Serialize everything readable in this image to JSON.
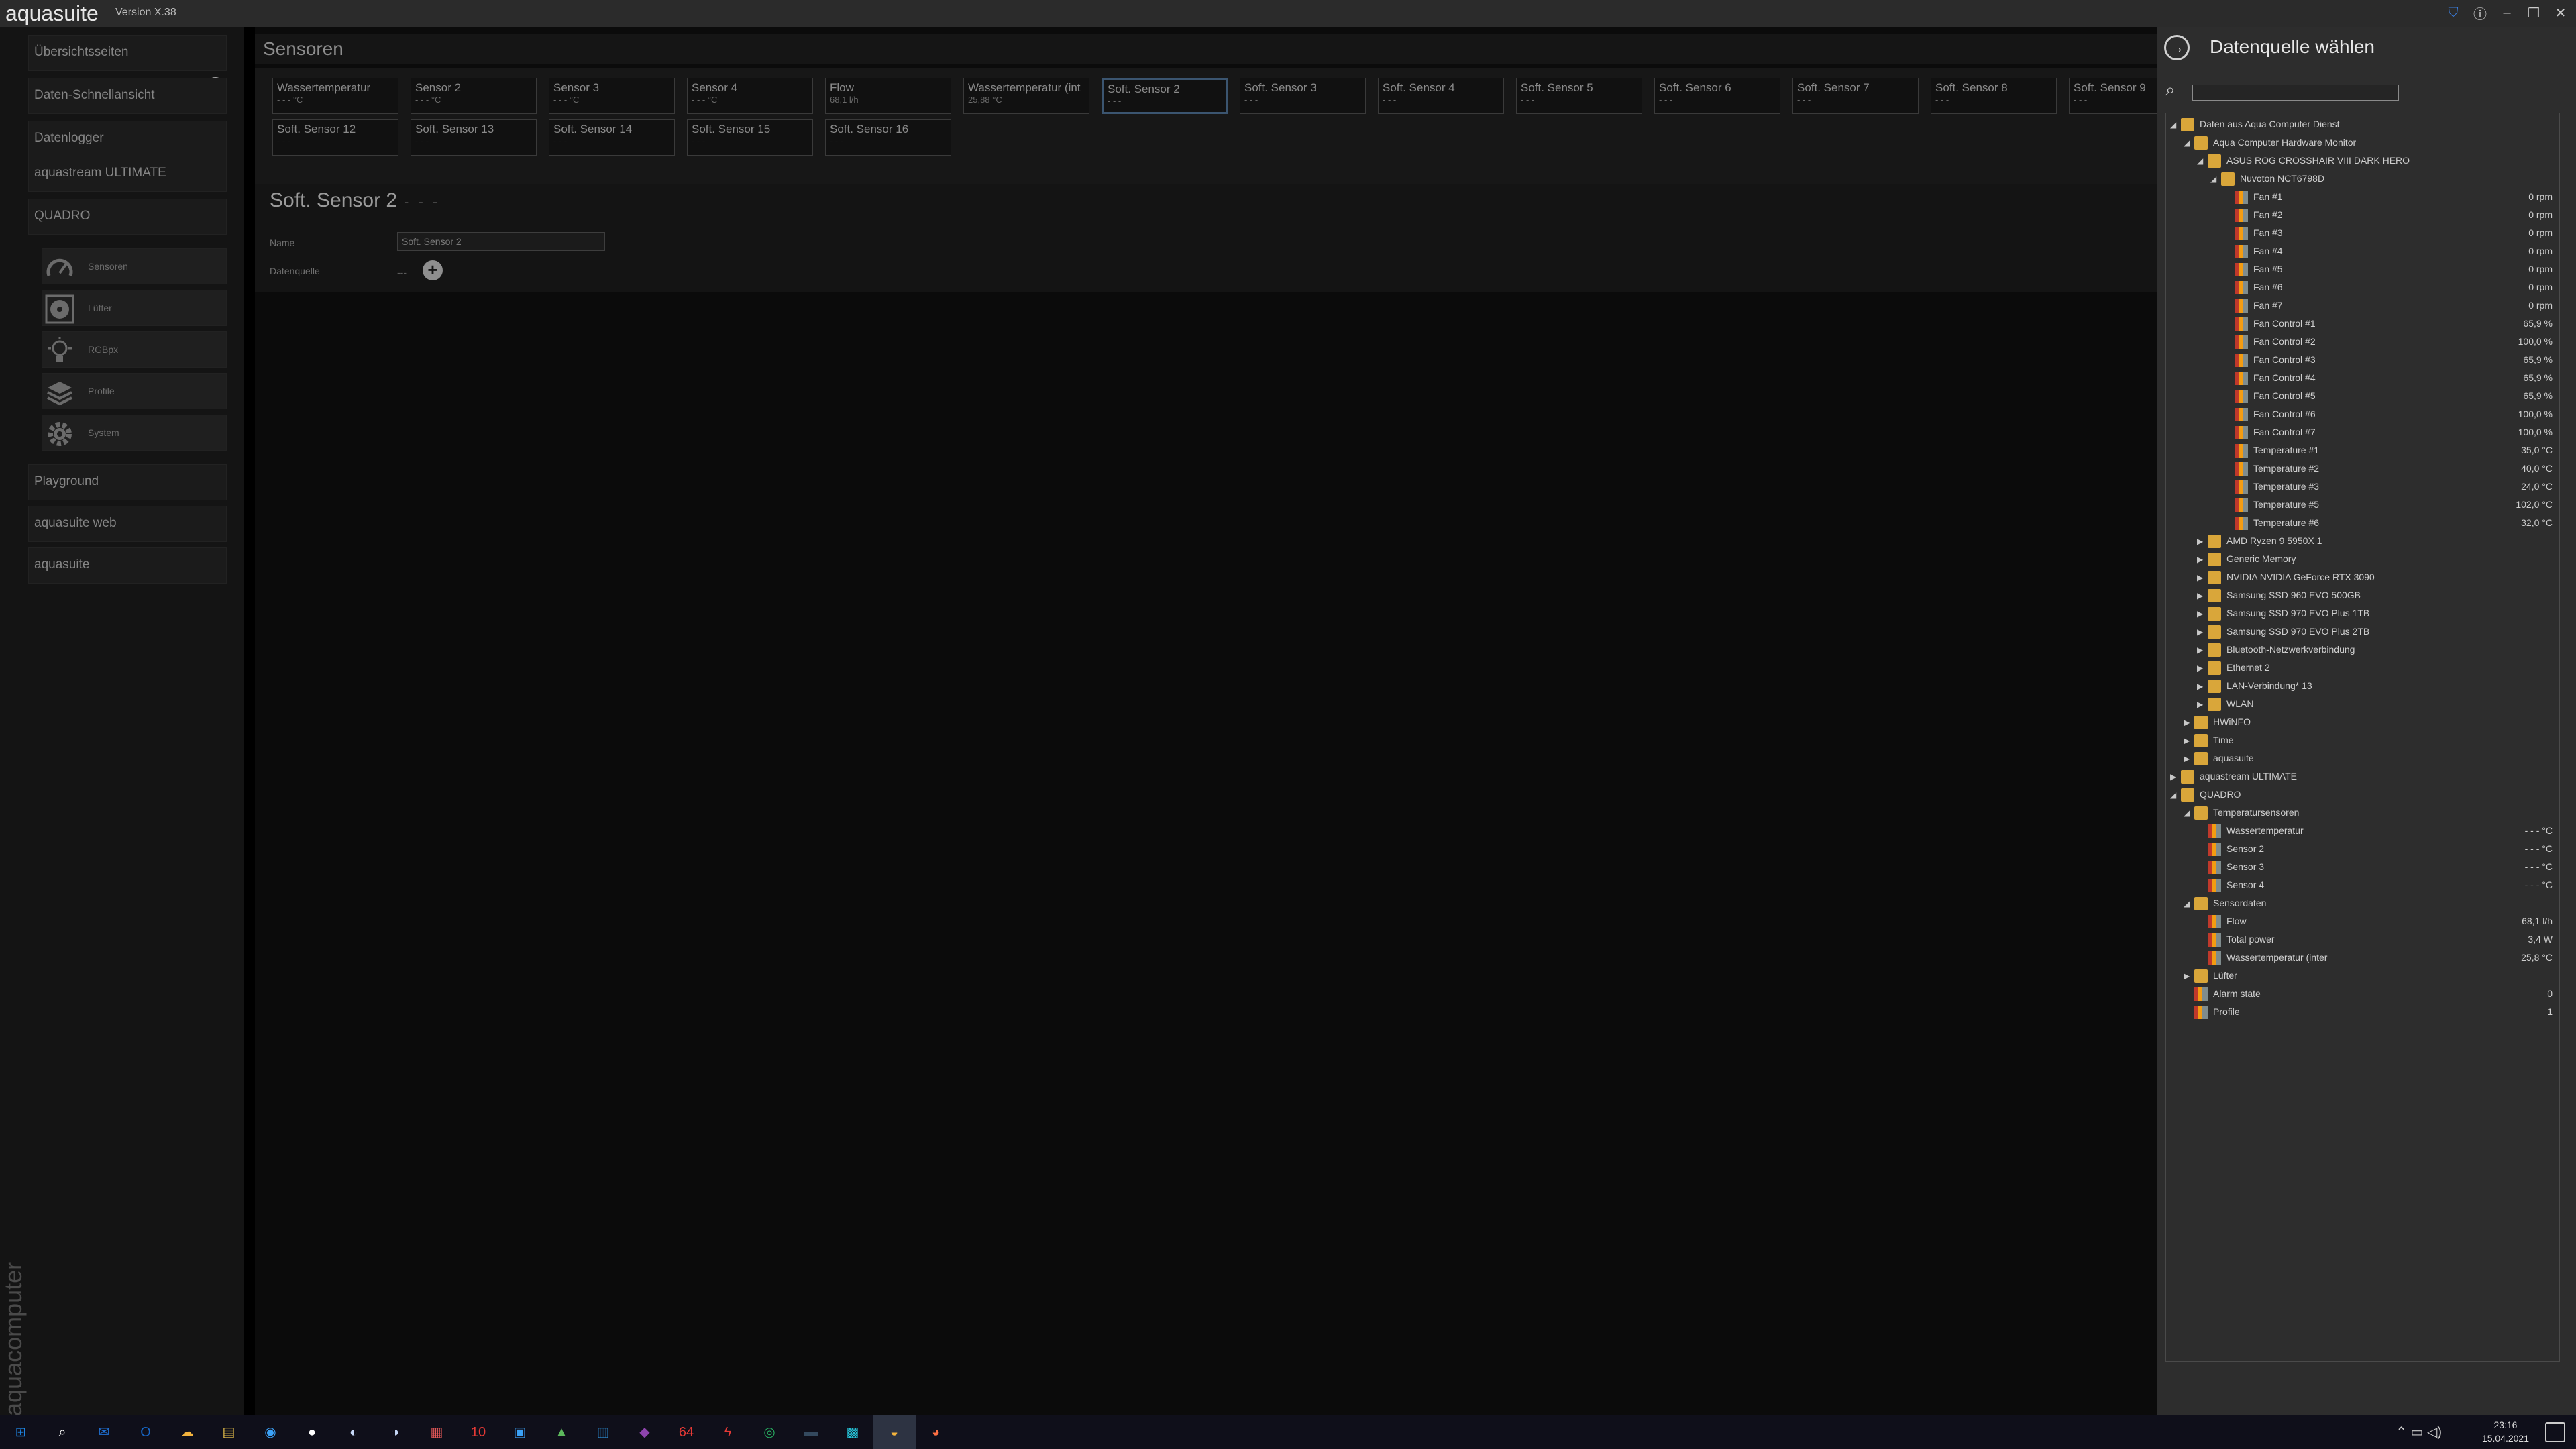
{
  "app": {
    "title": "aquasuite",
    "version": "Version X.38"
  },
  "sidebar": {
    "items": [
      {
        "label": "Übersichtsseiten"
      },
      {
        "label": "Daten-Schnellansicht"
      },
      {
        "label": "Datenlogger"
      },
      {
        "label": "aquastream ULTIMATE"
      },
      {
        "label": "QUADRO"
      },
      {
        "label": "Playground"
      },
      {
        "label": "aquasuite web"
      },
      {
        "label": "aquasuite"
      }
    ],
    "quadro_sub": [
      {
        "label": "Sensoren",
        "icon": "gauge-icon"
      },
      {
        "label": "Lüfter",
        "icon": "fan-icon"
      },
      {
        "label": "RGBpx",
        "icon": "bulb-icon"
      },
      {
        "label": "Profile",
        "icon": "layers-icon"
      },
      {
        "label": "System",
        "icon": "gear-icon"
      }
    ],
    "brand": "aquacomputer"
  },
  "main": {
    "header": "Sensoren",
    "tiles": [
      {
        "name": "Wassertemperatur",
        "value": "- - - °C"
      },
      {
        "name": "Sensor 2",
        "value": "- - - °C"
      },
      {
        "name": "Sensor 3",
        "value": "- - - °C"
      },
      {
        "name": "Sensor 4",
        "value": "- - - °C"
      },
      {
        "name": "Flow",
        "value": "68,1 l/h"
      },
      {
        "name": "Wassertemperatur (int",
        "value": "25,88 °C"
      },
      {
        "name": "Soft. Sensor 2",
        "value": "- - -"
      },
      {
        "name": "Soft. Sensor 3",
        "value": "- - -"
      },
      {
        "name": "Soft. Sensor 4",
        "value": "- - -"
      },
      {
        "name": "Soft. Sensor 5",
        "value": "- - -"
      },
      {
        "name": "Soft. Sensor 6",
        "value": "- - -"
      },
      {
        "name": "Soft. Sensor 7",
        "value": "- - -"
      },
      {
        "name": "Soft. Sensor 8",
        "value": "- - -"
      },
      {
        "name": "Soft. Sensor 9",
        "value": "- - -"
      },
      {
        "name": "Soft. Sensor 12",
        "value": "- - -"
      },
      {
        "name": "Soft. Sensor 13",
        "value": "- - -"
      },
      {
        "name": "Soft. Sensor 14",
        "value": "- - -"
      },
      {
        "name": "Soft. Sensor 15",
        "value": "- - -"
      },
      {
        "name": "Soft. Sensor 16",
        "value": "- - -"
      }
    ],
    "detail": {
      "title": "Soft. Sensor 2",
      "dashes": "- - -",
      "name_label": "Name",
      "name_value": "Soft. Sensor 2",
      "source_label": "Datenquelle",
      "source_value": "---"
    }
  },
  "panel": {
    "title": "Datenquelle wählen",
    "search_placeholder": "",
    "tree": [
      {
        "label": "Daten aus Aqua Computer Dienst",
        "value": "",
        "level": 0,
        "type": "folder",
        "expanded": true
      },
      {
        "label": "Aqua Computer Hardware Monitor",
        "value": "",
        "level": 1,
        "type": "folder",
        "expanded": true
      },
      {
        "label": "ASUS ROG CROSSHAIR VIII DARK HERO",
        "value": "",
        "level": 2,
        "type": "folder",
        "expanded": true
      },
      {
        "label": "Nuvoton NCT6798D",
        "value": "",
        "level": 3,
        "type": "folder",
        "expanded": true
      },
      {
        "label": "Fan #1",
        "value": "0 rpm",
        "level": 4,
        "type": "sensor"
      },
      {
        "label": "Fan #2",
        "value": "0 rpm",
        "level": 4,
        "type": "sensor"
      },
      {
        "label": "Fan #3",
        "value": "0 rpm",
        "level": 4,
        "type": "sensor"
      },
      {
        "label": "Fan #4",
        "value": "0 rpm",
        "level": 4,
        "type": "sensor"
      },
      {
        "label": "Fan #5",
        "value": "0 rpm",
        "level": 4,
        "type": "sensor"
      },
      {
        "label": "Fan #6",
        "value": "0 rpm",
        "level": 4,
        "type": "sensor"
      },
      {
        "label": "Fan #7",
        "value": "0 rpm",
        "level": 4,
        "type": "sensor"
      },
      {
        "label": "Fan Control #1",
        "value": "65,9 %",
        "level": 4,
        "type": "sensor"
      },
      {
        "label": "Fan Control #2",
        "value": "100,0 %",
        "level": 4,
        "type": "sensor"
      },
      {
        "label": "Fan Control #3",
        "value": "65,9 %",
        "level": 4,
        "type": "sensor"
      },
      {
        "label": "Fan Control #4",
        "value": "65,9 %",
        "level": 4,
        "type": "sensor"
      },
      {
        "label": "Fan Control #5",
        "value": "65,9 %",
        "level": 4,
        "type": "sensor"
      },
      {
        "label": "Fan Control #6",
        "value": "100,0 %",
        "level": 4,
        "type": "sensor"
      },
      {
        "label": "Fan Control #7",
        "value": "100,0 %",
        "level": 4,
        "type": "sensor"
      },
      {
        "label": "Temperature #1",
        "value": "35,0 °C",
        "level": 4,
        "type": "sensor"
      },
      {
        "label": "Temperature #2",
        "value": "40,0 °C",
        "level": 4,
        "type": "sensor"
      },
      {
        "label": "Temperature #3",
        "value": "24,0 °C",
        "level": 4,
        "type": "sensor"
      },
      {
        "label": "Temperature #5",
        "value": "102,0 °C",
        "level": 4,
        "type": "sensor"
      },
      {
        "label": "Temperature #6",
        "value": "32,0 °C",
        "level": 4,
        "type": "sensor"
      },
      {
        "label": "AMD Ryzen 9 5950X 1",
        "value": "",
        "level": 2,
        "type": "folder",
        "expanded": false
      },
      {
        "label": "Generic Memory",
        "value": "",
        "level": 2,
        "type": "folder",
        "expanded": false
      },
      {
        "label": "NVIDIA NVIDIA GeForce RTX 3090",
        "value": "",
        "level": 2,
        "type": "folder",
        "expanded": false
      },
      {
        "label": "Samsung SSD 960 EVO 500GB",
        "value": "",
        "level": 2,
        "type": "folder",
        "expanded": false
      },
      {
        "label": "Samsung SSD 970 EVO Plus 1TB",
        "value": "",
        "level": 2,
        "type": "folder",
        "expanded": false
      },
      {
        "label": "Samsung SSD 970 EVO Plus 2TB",
        "value": "",
        "level": 2,
        "type": "folder",
        "expanded": false
      },
      {
        "label": "Bluetooth-Netzwerkverbindung",
        "value": "",
        "level": 2,
        "type": "folder",
        "expanded": false
      },
      {
        "label": "Ethernet 2",
        "value": "",
        "level": 2,
        "type": "folder",
        "expanded": false
      },
      {
        "label": "LAN-Verbindung* 13",
        "value": "",
        "level": 2,
        "type": "folder",
        "expanded": false
      },
      {
        "label": "WLAN",
        "value": "",
        "level": 2,
        "type": "folder",
        "expanded": false
      },
      {
        "label": "HWiNFO",
        "value": "",
        "level": 1,
        "type": "folder",
        "expanded": false
      },
      {
        "label": "Time",
        "value": "",
        "level": 1,
        "type": "folder",
        "expanded": false
      },
      {
        "label": "aquasuite",
        "value": "",
        "level": 1,
        "type": "folder",
        "expanded": false
      },
      {
        "label": "aquastream ULTIMATE",
        "value": "",
        "level": 0,
        "type": "folder",
        "expanded": false
      },
      {
        "label": "QUADRO",
        "value": "",
        "level": 0,
        "type": "folder",
        "expanded": true
      },
      {
        "label": "Temperatursensoren",
        "value": "",
        "level": 1,
        "type": "folder",
        "expanded": true
      },
      {
        "label": "Wassertemperatur",
        "value": "- - - °C",
        "level": 2,
        "type": "sensor"
      },
      {
        "label": "Sensor 2",
        "value": "- - - °C",
        "level": 2,
        "type": "sensor"
      },
      {
        "label": "Sensor 3",
        "value": "- - - °C",
        "level": 2,
        "type": "sensor"
      },
      {
        "label": "Sensor 4",
        "value": "- - - °C",
        "level": 2,
        "type": "sensor"
      },
      {
        "label": "Sensordaten",
        "value": "",
        "level": 1,
        "type": "folder",
        "expanded": true
      },
      {
        "label": "Flow",
        "value": "68,1 l/h",
        "level": 2,
        "type": "sensor"
      },
      {
        "label": "Total power",
        "value": "3,4 W",
        "level": 2,
        "type": "sensor"
      },
      {
        "label": "Wassertemperatur (inter",
        "value": "25,8 °C",
        "level": 2,
        "type": "sensor"
      },
      {
        "label": "Lüfter",
        "value": "",
        "level": 1,
        "type": "folder",
        "expanded": false
      },
      {
        "label": "Alarm state",
        "value": "0",
        "level": 1,
        "type": "sensor"
      },
      {
        "label": "Profile",
        "value": "1",
        "level": 1,
        "type": "sensor"
      }
    ]
  },
  "taskbar": {
    "icons": [
      {
        "name": "start-icon",
        "glyph": "⊞",
        "color": "#1f8ef1"
      },
      {
        "name": "search-icon",
        "glyph": "⌕",
        "color": "#ffffff"
      },
      {
        "name": "mail-icon",
        "glyph": "✉",
        "color": "#1f6fd1"
      },
      {
        "name": "outlook-icon",
        "glyph": "O",
        "color": "#1666c5"
      },
      {
        "name": "weather-icon",
        "glyph": "☁",
        "color": "#f3b33d"
      },
      {
        "name": "explorer-icon",
        "glyph": "▤",
        "color": "#f2c94c"
      },
      {
        "name": "browser-icon",
        "glyph": "◉",
        "color": "#3ba1f6"
      },
      {
        "name": "app-icon",
        "glyph": "●",
        "color": "#ffffff"
      },
      {
        "name": "app-icon-2",
        "glyph": "◐",
        "color": "#c6d8f7"
      },
      {
        "name": "app-icon-3",
        "glyph": "◑",
        "color": "#c6d8f7"
      },
      {
        "name": "app-icon-4",
        "glyph": "▦",
        "color": "#e45858"
      },
      {
        "name": "app-icon-5",
        "glyph": "10",
        "color": "#e53935"
      },
      {
        "name": "app-icon-6",
        "glyph": "▣",
        "color": "#3ba1f6"
      },
      {
        "name": "app-icon-7",
        "glyph": "▲",
        "color": "#5cb85c"
      },
      {
        "name": "app-icon-8",
        "glyph": "▥",
        "color": "#2c8fd6"
      },
      {
        "name": "app-icon-9",
        "glyph": "◆",
        "color": "#8e44ad"
      },
      {
        "name": "app-icon-10",
        "glyph": "64",
        "color": "#e53935"
      },
      {
        "name": "app-icon-11",
        "glyph": "ϟ",
        "color": "#e53935"
      },
      {
        "name": "app-icon-12",
        "glyph": "◎",
        "color": "#27ae60"
      },
      {
        "name": "app-icon-13",
        "glyph": "▬",
        "color": "#34495e"
      },
      {
        "name": "app-icon-14",
        "glyph": "▩",
        "color": "#26c6da"
      },
      {
        "name": "aquasuite-icon",
        "glyph": "◒",
        "color": "#f3b33d"
      },
      {
        "name": "firefox-icon",
        "glyph": "◕",
        "color": "#ff7043"
      }
    ],
    "time": "23:16",
    "date": "15.04.2021"
  }
}
